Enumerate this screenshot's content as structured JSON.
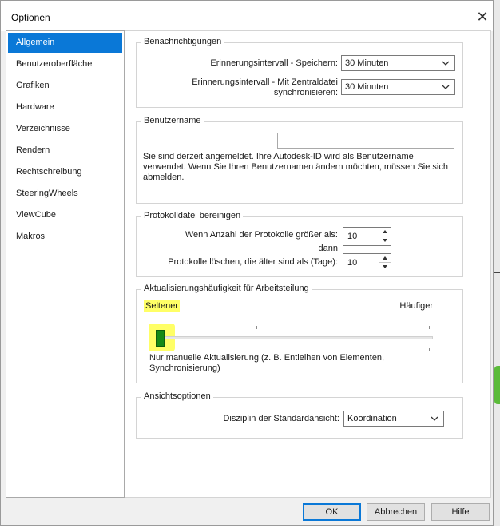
{
  "window": {
    "title": "Optionen"
  },
  "nav": {
    "items": [
      {
        "label": "Allgemein",
        "active": true
      },
      {
        "label": "Benutzeroberfläche"
      },
      {
        "label": "Grafiken"
      },
      {
        "label": "Hardware"
      },
      {
        "label": "Verzeichnisse"
      },
      {
        "label": "Rendern"
      },
      {
        "label": "Rechtschreibung"
      },
      {
        "label": "SteeringWheels"
      },
      {
        "label": "ViewCube"
      },
      {
        "label": "Makros"
      }
    ]
  },
  "notifications": {
    "title": "Benachrichtigungen",
    "save_label": "Erinnerungsintervall - Speichern:",
    "save_value": "30 Minuten",
    "sync_label_1": "Erinnerungsintervall - Mit Zentraldatei",
    "sync_label_2": "synchronisieren:",
    "sync_value": "30 Minuten"
  },
  "username": {
    "title": "Benutzername",
    "value": "",
    "info_1": "Sie sind derzeit angemeldet. Ihre Autodesk-ID wird als Benutzername",
    "info_2": "verwendet. Wenn Sie Ihren Benutzernamen ändern möchten, müssen Sie sich",
    "info_3": "abmelden."
  },
  "logs": {
    "title": "Protokolldatei bereinigen",
    "count_label": "Wenn Anzahl der Protokolle größer als:",
    "count_value": "10",
    "then_label": "dann",
    "age_label": "Protokolle löschen, die älter sind als (Tage):",
    "age_value": "10"
  },
  "worksharing": {
    "title": "Aktualisierungshäufigkeit für Arbeitsteilung",
    "less_label": "Seltener",
    "more_label": "Häufiger",
    "slider_level": 0,
    "desc_1": "Nur manuelle Aktualisierung (z. B. Entleihen von Elementen,",
    "desc_2": "Synchronisierung)"
  },
  "view_options": {
    "title": "Ansichtsoptionen",
    "discipline_label": "Disziplin der Standardansicht:",
    "discipline_value": "Koordination"
  },
  "buttons": {
    "ok": "OK",
    "cancel": "Abbrechen",
    "help": "Hilfe"
  },
  "colors": {
    "accent": "#0a78d7",
    "highlight": "#ffff66",
    "thumb": "#168a16"
  }
}
